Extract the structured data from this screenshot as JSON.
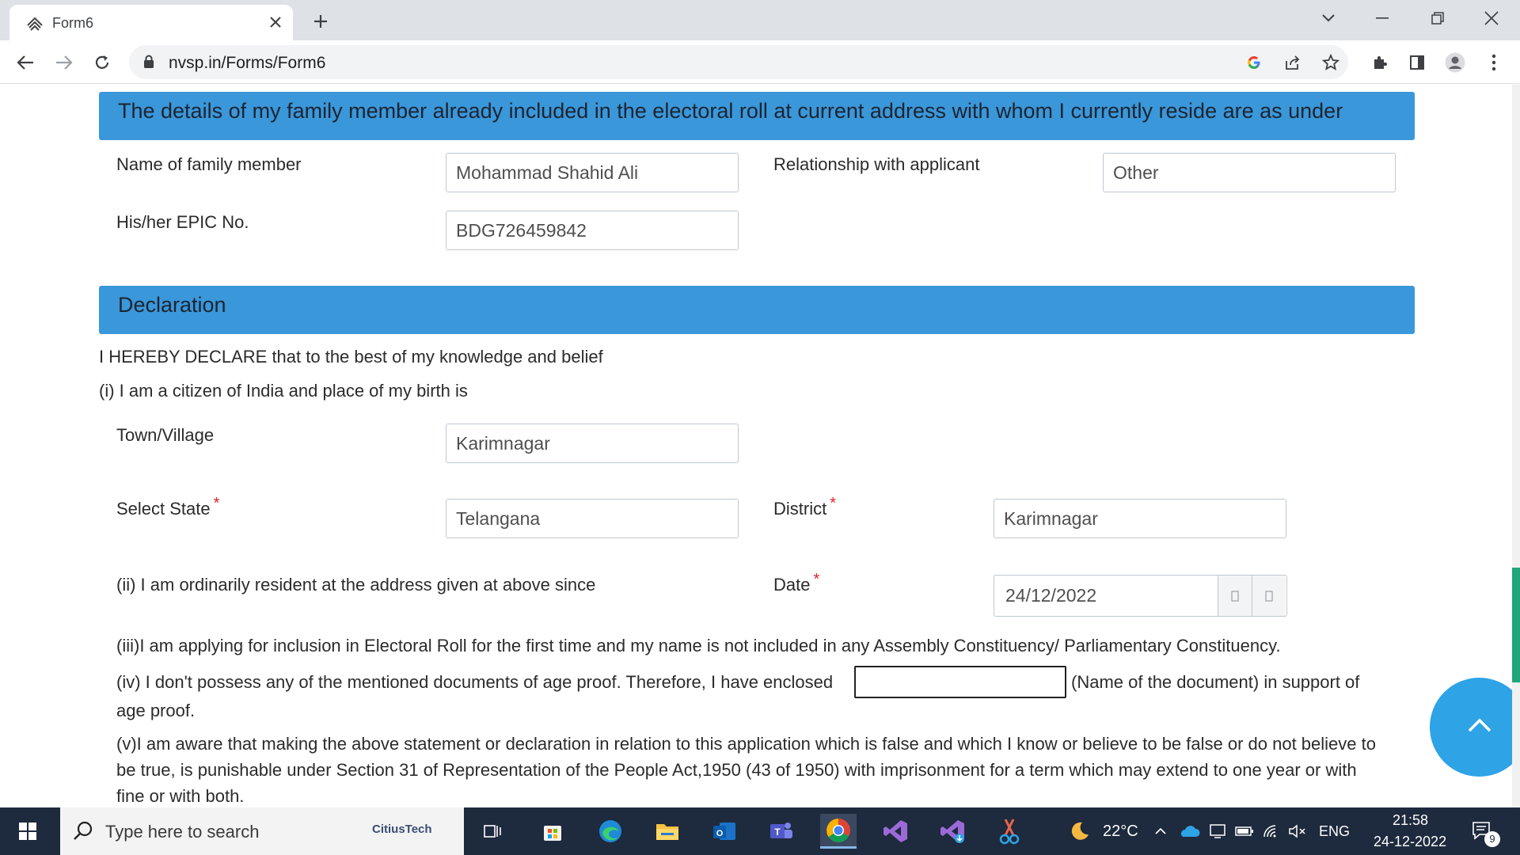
{
  "browser": {
    "tab_title": "Form6",
    "url": "nvsp.in/Forms/Form6"
  },
  "family_section": {
    "heading": "The details of my family member already included in the electoral roll at current address with whom I currently reside are as under",
    "name_label": "Name of family member",
    "name_value": "Mohammad Shahid Ali",
    "relationship_label": "Relationship with applicant",
    "relationship_value": "Other",
    "epic_label": "His/her EPIC No.",
    "epic_value": "BDG726459842"
  },
  "declaration": {
    "heading": "Declaration",
    "intro": "I HEREBY DECLARE that to the best of my knowledge and belief",
    "citizen": "(i) I am a citizen of India and place of my birth is",
    "town_label": "Town/Village",
    "town_value": "Karimnagar",
    "state_label": "Select State",
    "state_value": "Telangana",
    "district_label": "District",
    "district_value": "Karimnagar",
    "required_mark": "*",
    "resident_text": "(ii) I am ordinarily resident at the address given at above since",
    "date_label": "Date",
    "date_value": "24/12/2022",
    "inclusion_text": "(iii)I am applying for inclusion in Electoral Roll for the first time and my name is not included in any Assembly Constituency/ Parliamentary Constituency.",
    "age_proof_before": "(iv) I don't possess any of the mentioned documents of age proof. Therefore, I have enclosed",
    "age_proof_after": "(Name of the document) in support of",
    "age_proof_end": "age proof.",
    "aware_line1": "(v)I am aware that making the above statement or declaration in relation to this application which is false and which I know or believe to be false or do not believe to",
    "aware_line2": "be true, is punishable under Section 31 of Representation of the People Act,1950 (43 of 1950) with imprisonment for a term which may extend to one year or with",
    "aware_line3": "fine or with both."
  },
  "taskbar": {
    "search_placeholder": "Type here to search",
    "search_brand": "CitiusTech",
    "temperature": "22°C",
    "language": "ENG",
    "time": "21:58",
    "date": "24-12-2022",
    "notification_count": "9"
  },
  "colors": {
    "section_header": "#3a97da",
    "scroll_top_button": "#2ea3e6",
    "required": "#e02424",
    "taskbar": "#1e2a3d"
  }
}
